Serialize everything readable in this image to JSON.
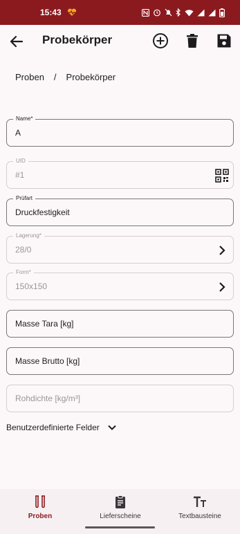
{
  "status_bar": {
    "time": "15:43",
    "bg_color": "#8b1a1f",
    "left_icons": [
      "heart-rate-icon"
    ],
    "right_icons": [
      "nfc-icon",
      "alarm-icon",
      "mute-icon",
      "bluetooth-icon",
      "wifi-icon",
      "signal-icon",
      "signal-icon",
      "battery-icon"
    ]
  },
  "app_bar": {
    "title": "Probekörper",
    "back_icon": "arrow-left-icon",
    "actions": [
      "add-circle-icon",
      "delete-icon",
      "save-icon"
    ]
  },
  "breadcrumb": {
    "items": [
      "Proben",
      "Probekörper"
    ],
    "separator": "/"
  },
  "fields": {
    "name": {
      "label": "Name*",
      "value": "A"
    },
    "uid": {
      "label": "UID",
      "value": "#1",
      "icon": "qr-code-icon"
    },
    "pruefart": {
      "label": "Prüfart",
      "value": "Druckfestigkeit"
    },
    "lagerung": {
      "label": "Lagerung*",
      "value": "28/0",
      "icon": "chevron-right-icon"
    },
    "form": {
      "label": "Form*",
      "value": "150x150",
      "icon": "chevron-right-icon"
    },
    "masse_tara": {
      "placeholder": "Masse Tara [kg]"
    },
    "masse_brutto": {
      "placeholder": "Masse Brutto [kg]"
    },
    "rohdichte": {
      "placeholder": "Rohdichte [kg/m³]"
    }
  },
  "custom_fields": {
    "label": "Benutzerdefinierte Felder",
    "icon": "chevron-down-icon"
  },
  "bottom_nav": {
    "items": [
      {
        "label": "Proben",
        "icon": "test-tubes-icon",
        "active": true
      },
      {
        "label": "Lieferscheine",
        "icon": "clipboard-icon",
        "active": false
      },
      {
        "label": "Textbausteine",
        "icon": "text-size-icon",
        "active": false
      }
    ],
    "active_color": "#8b1a1f"
  }
}
